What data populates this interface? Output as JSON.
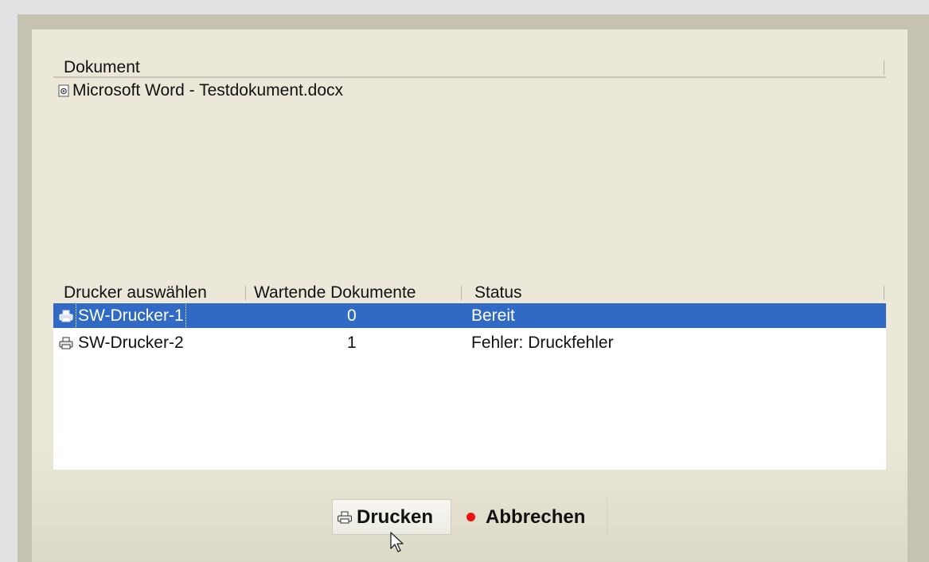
{
  "document_list": {
    "header": "Dokument",
    "items": [
      {
        "name": "Microsoft Word - Testdokument.docx",
        "icon": "document-icon"
      }
    ]
  },
  "printer_table": {
    "columns": [
      "Drucker auswählen",
      "Wartende Dokumente",
      "Status"
    ],
    "rows": [
      {
        "name": "SW-Drucker-1",
        "waiting": "0",
        "status": "Bereit",
        "selected": true,
        "icon": "printer-icon"
      },
      {
        "name": "SW-Drucker-2",
        "waiting": "1",
        "status": "Fehler: Druckfehler",
        "selected": false,
        "icon": "printer-icon"
      }
    ]
  },
  "buttons": {
    "print_label": "Drucken",
    "print_icon": "printer-icon",
    "cancel_label": "Abbrechen",
    "cancel_icon": "red-dot-icon"
  },
  "colors": {
    "selection": "#316ac5",
    "cancel_dot": "#ee1111",
    "panel": "#ebe8da"
  }
}
